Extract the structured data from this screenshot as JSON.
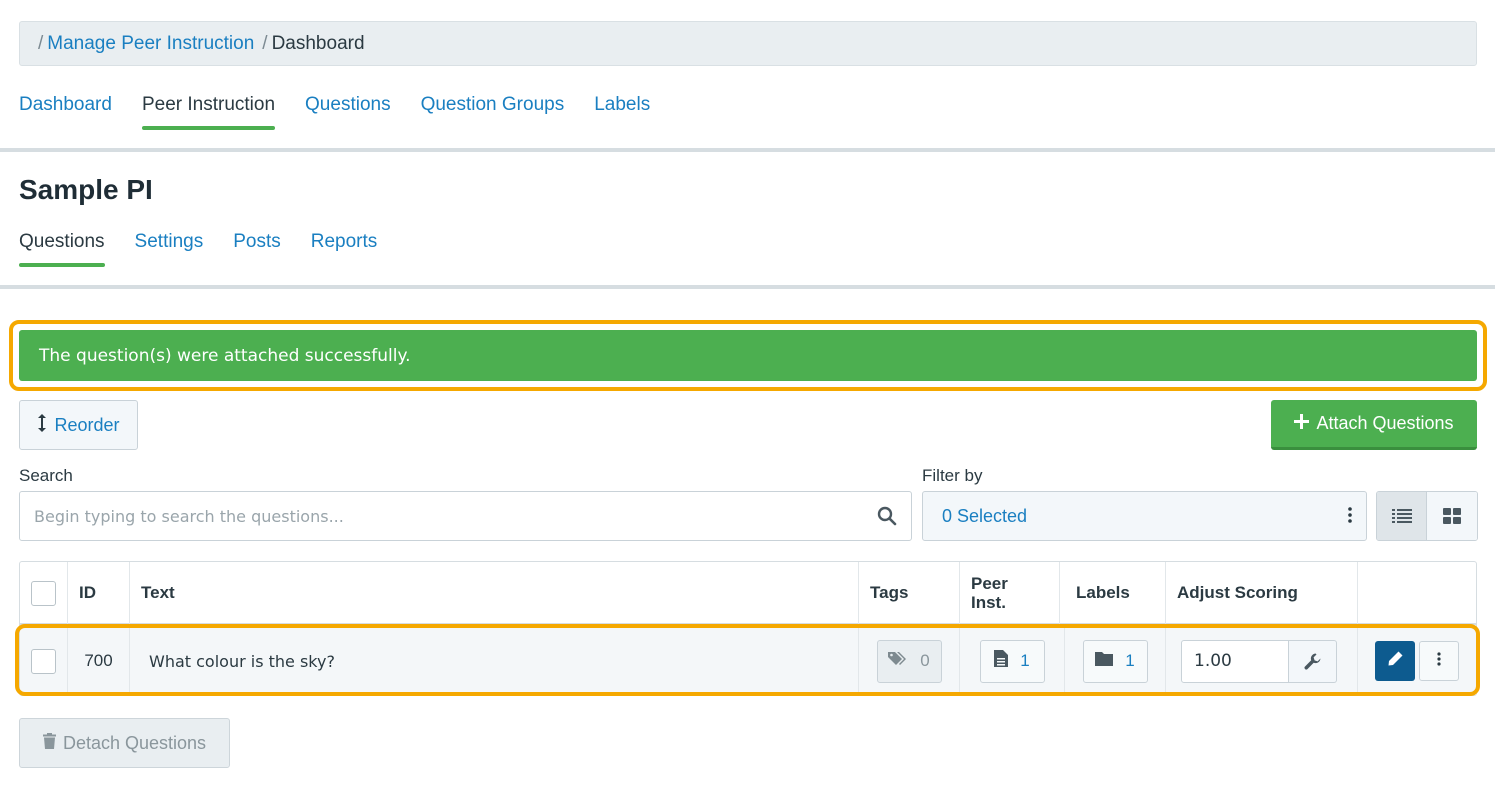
{
  "breadcrumb": {
    "sep1": "/",
    "link": "Manage Peer Instruction",
    "sep2": "/",
    "current": "Dashboard"
  },
  "top_tabs": [
    {
      "label": "Dashboard",
      "active": false
    },
    {
      "label": "Peer Instruction",
      "active": true
    },
    {
      "label": "Questions",
      "active": false
    },
    {
      "label": "Question Groups",
      "active": false
    },
    {
      "label": "Labels",
      "active": false
    }
  ],
  "page_title": "Sample PI",
  "sub_tabs": [
    {
      "label": "Questions",
      "active": true
    },
    {
      "label": "Settings",
      "active": false
    },
    {
      "label": "Posts",
      "active": false
    },
    {
      "label": "Reports",
      "active": false
    }
  ],
  "alert": {
    "message": "The question(s) were attached successfully."
  },
  "toolbar": {
    "reorder_label": "Reorder",
    "reorder_icon": "vertical-arrows-icon",
    "attach_label": "Attach Questions",
    "attach_icon": "plus-icon"
  },
  "search": {
    "label": "Search",
    "placeholder": "Begin typing to search the questions...",
    "value": ""
  },
  "filter": {
    "label": "Filter by",
    "value": "0 Selected"
  },
  "view_toggle": {
    "active": "list",
    "options": [
      "list-view-icon",
      "grid-view-icon"
    ]
  },
  "table": {
    "columns": [
      "ID",
      "Text",
      "Tags",
      "Peer Inst.",
      "Labels",
      "Adjust Scoring"
    ],
    "rows": [
      {
        "id": "700",
        "text": "What colour is the sky?",
        "tags": "0",
        "peer_inst": "1",
        "labels": "1",
        "scoring": "1.00"
      }
    ]
  },
  "footer": {
    "detach_label": "Detach Questions",
    "detach_icon": "trash-icon"
  },
  "colors": {
    "accent_green": "#4caf50",
    "link_blue": "#1a7fc1",
    "edit_blue": "#0d5b8f",
    "highlight_orange": "#f5a800"
  }
}
